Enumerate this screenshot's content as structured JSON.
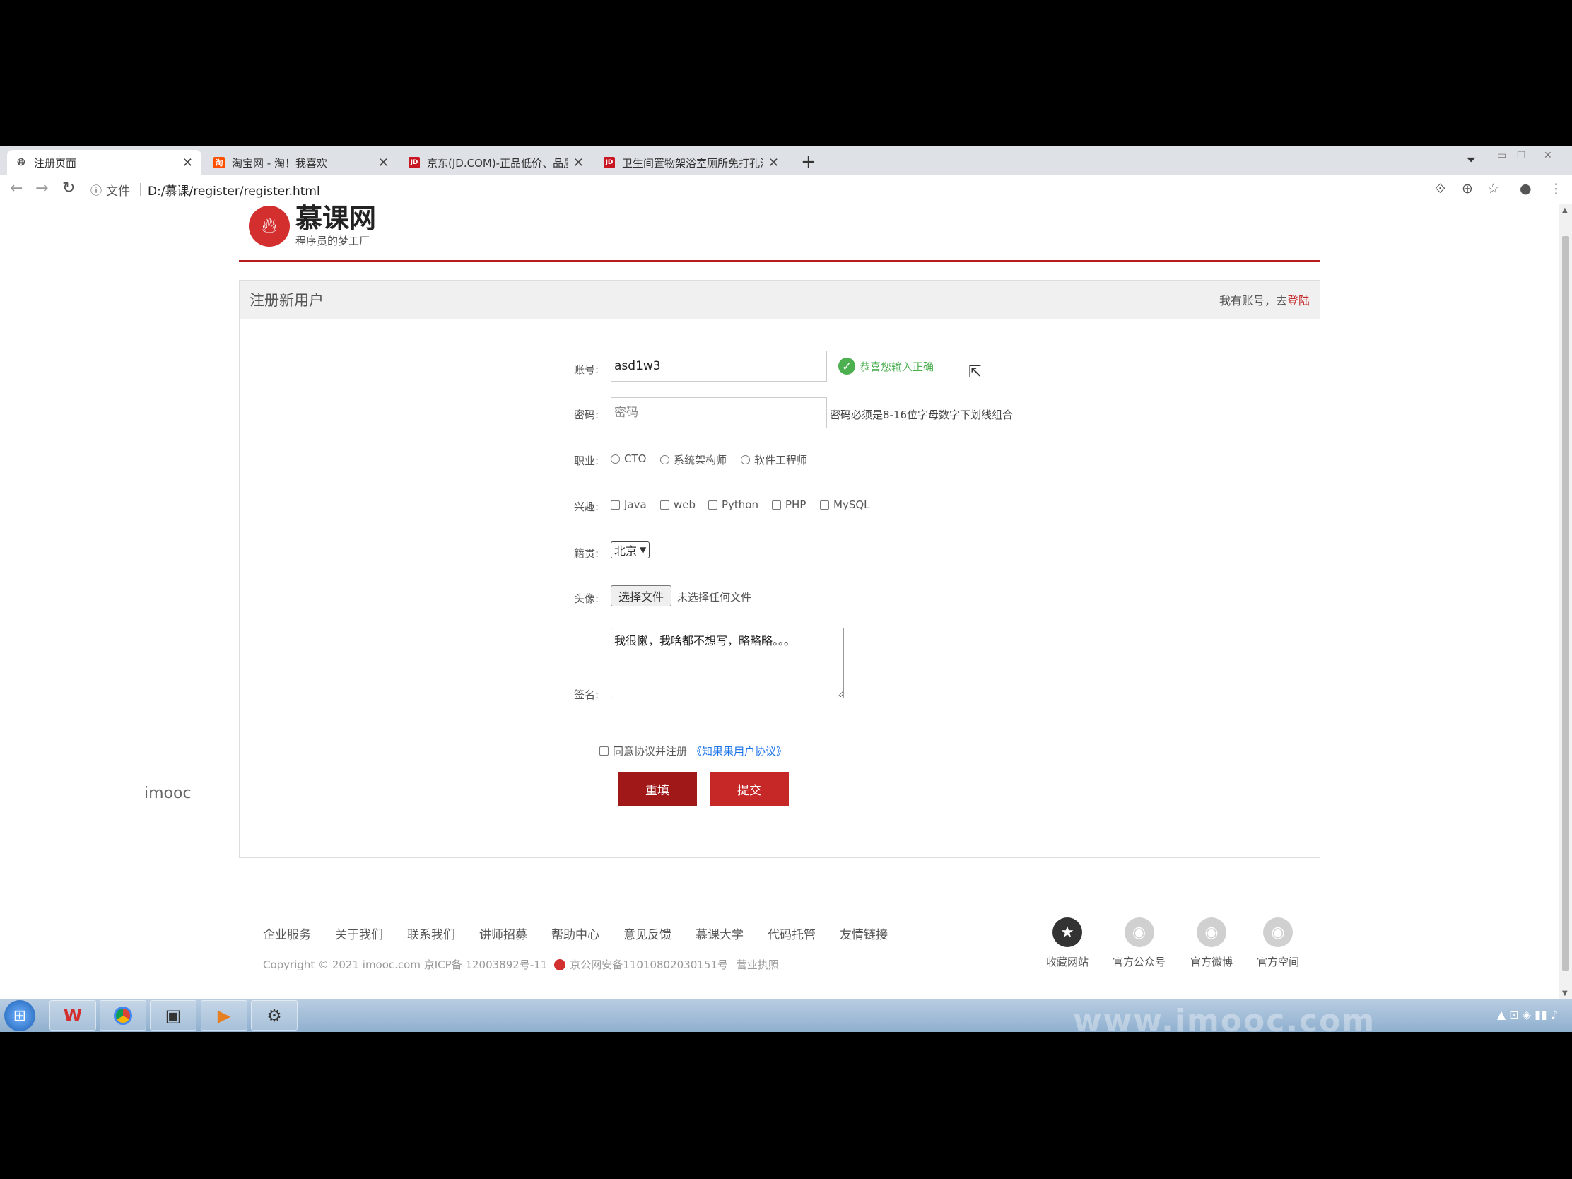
{
  "browser": {
    "tabs": [
      {
        "title": "注册页面",
        "active": true,
        "favicon": "page-icon"
      },
      {
        "title": "淘宝网 - 淘！我喜欢",
        "active": false,
        "favicon": "taobao-icon"
      },
      {
        "title": "京东(JD.COM)-正品低价、品质",
        "active": false,
        "favicon": "jd-icon"
      },
      {
        "title": "卫生间置物架浴室厕所免打孔洗",
        "active": false,
        "favicon": "jd-icon"
      }
    ],
    "close_glyph": "✕",
    "new_tab": "+",
    "address_label": "文件",
    "url": "D:/慕课/register/register.html",
    "jd_favicon_text": "JD",
    "taobao_favicon_text": "淘"
  },
  "logo": {
    "name": "慕课网",
    "slogan": "程序员的梦工厂"
  },
  "panel": {
    "title": "注册新用户",
    "login_prefix": "我有账号，去",
    "login_link": "登陆"
  },
  "form": {
    "account": {
      "label": "账号:",
      "value": "asd1w3",
      "ok_message": "恭喜您输入正确"
    },
    "password": {
      "label": "密码:",
      "placeholder": "密码",
      "hint": "密码必须是8-16位字母数字下划线组合"
    },
    "job": {
      "label": "职业:",
      "options": [
        "CTO",
        "系统架构师",
        "软件工程师"
      ]
    },
    "hobby": {
      "label": "兴趣:",
      "options": [
        "Java",
        "web",
        "Python",
        "PHP",
        "MySQL"
      ]
    },
    "hometown": {
      "label": "籍贯:",
      "selected": "北京"
    },
    "avatar": {
      "label": "头像:",
      "button": "选择文件",
      "status": "未选择任何文件"
    },
    "signature": {
      "label": "签名:",
      "value": "我很懒，我啥都不想写，略略略。。。"
    },
    "agree": {
      "text": "同意协议并注册",
      "link": "《知果果用户协议》"
    },
    "reset": "重填",
    "submit": "提交"
  },
  "side_text": "imooc",
  "footer": {
    "links": [
      "企业服务",
      "关于我们",
      "联系我们",
      "讲师招募",
      "帮助中心",
      "意见反馈",
      "慕课大学",
      "代码托管",
      "友情链接"
    ],
    "copyright": "Copyright © 2021 imooc.com  京ICP备 12003892号-11",
    "police": "京公网安备11010802030151号",
    "license": "营业执照",
    "social": [
      {
        "label": "收藏网站",
        "icon": "star-icon",
        "color": "#333333"
      },
      {
        "label": "官方公众号",
        "icon": "wechat-icon",
        "color": "#d0d0d0"
      },
      {
        "label": "官方微博",
        "icon": "weibo-icon",
        "color": "#d0d0d0"
      },
      {
        "label": "官方空间",
        "icon": "qq-icon",
        "color": "#d0d0d0"
      }
    ]
  },
  "taskbar": {
    "watermark": "www.imooc.com"
  },
  "colors": {
    "brand_red": "#c62828",
    "ok_green": "#4caf50",
    "link_blue": "#1a73e8"
  }
}
